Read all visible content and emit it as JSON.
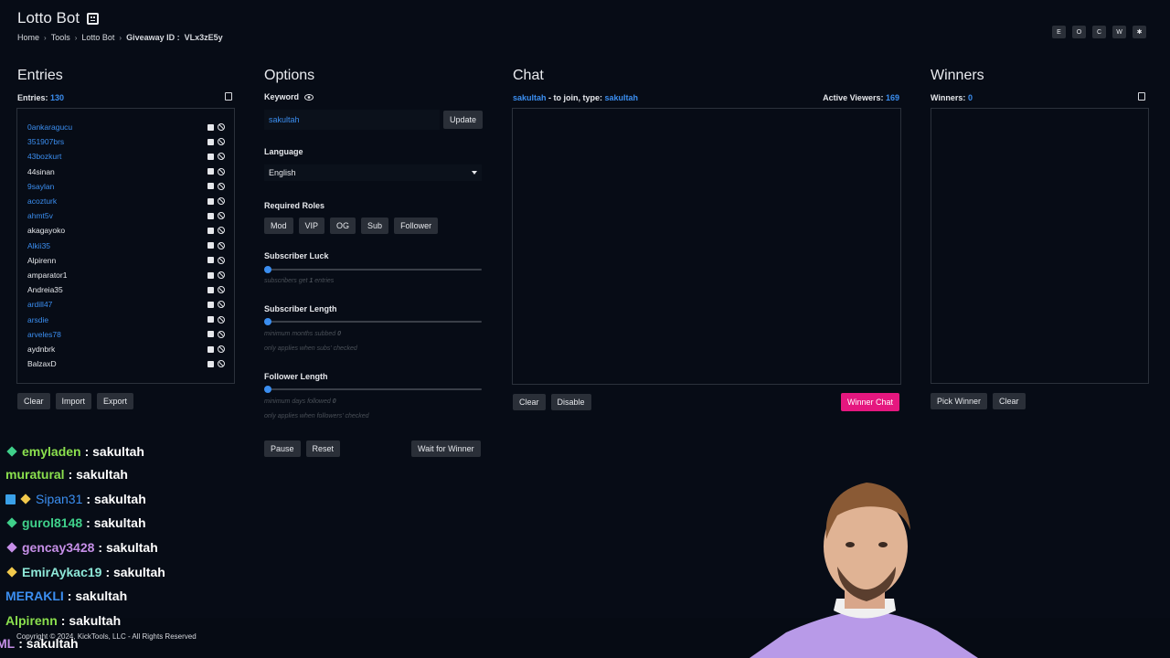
{
  "header": {
    "title": "Lotto Bot",
    "breadcrumb": [
      "Home",
      "Tools",
      "Lotto Bot"
    ],
    "giveaway_label": "Giveaway ID :",
    "giveaway_id": "VLx3zE5y",
    "top_buttons": [
      "E",
      "O",
      "C",
      "W",
      "✱"
    ]
  },
  "entries": {
    "title": "Entries",
    "count_label": "Entries:",
    "count": "130",
    "items": [
      {
        "name": "0ankaragucu",
        "color": "#3b8ef0"
      },
      {
        "name": "351907brs",
        "color": "#3b8ef0"
      },
      {
        "name": "43bozkurt",
        "color": "#3b8ef0"
      },
      {
        "name": "44sinan",
        "color": "#e6e8ec"
      },
      {
        "name": "9saylan",
        "color": "#3b8ef0"
      },
      {
        "name": "acozturk",
        "color": "#3b8ef0"
      },
      {
        "name": "ahmt5v",
        "color": "#3b8ef0"
      },
      {
        "name": "akagayoko",
        "color": "#e6e8ec"
      },
      {
        "name": "Alkii35",
        "color": "#3b8ef0"
      },
      {
        "name": "Alpirenn",
        "color": "#e6e8ec"
      },
      {
        "name": "amparator1",
        "color": "#e6e8ec"
      },
      {
        "name": "Andreia35",
        "color": "#e6e8ec"
      },
      {
        "name": "ardill47",
        "color": "#3b8ef0"
      },
      {
        "name": "arsdie",
        "color": "#3b8ef0"
      },
      {
        "name": "arveles78",
        "color": "#3b8ef0"
      },
      {
        "name": "aydnbrk",
        "color": "#e6e8ec"
      },
      {
        "name": "BalzaxD",
        "color": "#e6e8ec"
      }
    ],
    "buttons": {
      "clear": "Clear",
      "import": "Import",
      "export": "Export"
    }
  },
  "options": {
    "title": "Options",
    "keyword_label": "Keyword",
    "keyword_value": "sakultah",
    "update_button": "Update",
    "language_label": "Language",
    "language_value": "English",
    "required_roles_label": "Required Roles",
    "roles": [
      "Mod",
      "VIP",
      "OG",
      "Sub",
      "Follower"
    ],
    "subscriber_luck_label": "Subscriber Luck",
    "subscriber_luck_hint_pre": "subscribers get",
    "subscriber_luck_value": "1",
    "subscriber_luck_hint_post": "entries",
    "subscriber_length_label": "Subscriber Length",
    "subscriber_length_hint": "minimum months subbed",
    "subscriber_length_value": "0",
    "subscriber_length_note": "only applies when subs' checked",
    "follower_length_label": "Follower Length",
    "follower_length_hint": "minimum days followed",
    "follower_length_value": "0",
    "follower_length_note": "only applies when followers' checked",
    "buttons": {
      "pause": "Pause",
      "reset": "Reset",
      "wait": "Wait for Winner"
    }
  },
  "chat": {
    "title": "Chat",
    "join_user": "sakultah",
    "join_text": " - to join, type: ",
    "join_keyword": "sakultah",
    "viewers_label": "Active Viewers:",
    "viewers_count": "169",
    "buttons": {
      "clear": "Clear",
      "disable": "Disable",
      "winner_chat": "Winner Chat"
    },
    "accent": "#e5177f"
  },
  "winners": {
    "title": "Winners",
    "count_label": "Winners:",
    "count": "0",
    "buttons": {
      "pick": "Pick Winner",
      "clear": "Clear"
    }
  },
  "stream_chat": {
    "messages": [
      {
        "user": "emyladen",
        "text": ": sakultah",
        "color": "#8be04e"
      },
      {
        "user": "muratural",
        "text": ": sakultah",
        "color": "#8be04e"
      },
      {
        "user": "Sipan31",
        "text": ": sakultah",
        "color": "#3b8ef0"
      },
      {
        "user": "gurol8148",
        "text": ": sakultah",
        "color": "#3fd08a"
      },
      {
        "user": "gencay3428",
        "text": ": sakultah",
        "color": "#c68fe8"
      },
      {
        "user": "EmirAykac19",
        "text": ": sakultah",
        "color": "#8ee8d8"
      },
      {
        "user": "MERAKLI",
        "text": ": sakultah",
        "color": "#3b8ef0"
      },
      {
        "user": "Alpirenn",
        "text": ": sakultah",
        "color": "#8be04e"
      },
      {
        "user": "ML",
        "text": ": sakultah",
        "color": "#c68fe8"
      }
    ]
  },
  "footer": {
    "copyright": "Copyright © 2024, KickTools, LLC - All Rights Reserved"
  }
}
